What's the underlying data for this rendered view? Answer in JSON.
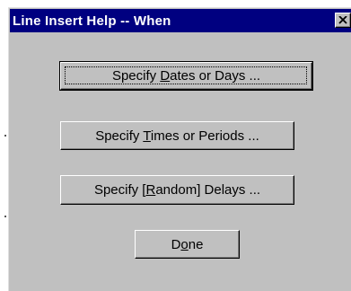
{
  "window": {
    "title": "Line Insert Help -- When"
  },
  "buttons": {
    "dates": {
      "pre": "Specify ",
      "mnemonic": "D",
      "post": "ates or Days ..."
    },
    "times": {
      "pre": "Specify ",
      "mnemonic": "T",
      "post": "imes or Periods ..."
    },
    "delays": {
      "pre": "Specify [",
      "mnemonic": "R",
      "post": "andom] Delays ..."
    },
    "done": {
      "pre": "D",
      "mnemonic": "o",
      "post": "ne"
    }
  },
  "icons": {
    "close": "close-icon"
  },
  "colors": {
    "titlebar": "#000080",
    "face": "#c0c0c0"
  }
}
